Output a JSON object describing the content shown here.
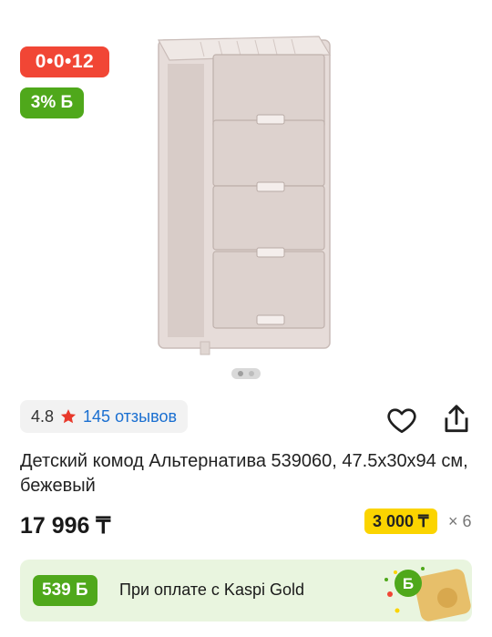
{
  "badges": {
    "installment": "0•0•12",
    "bonus": "3% Б"
  },
  "gallery": {
    "image_name": "product-image",
    "pages": 2,
    "active_page": 1
  },
  "rating": {
    "value": "4.8",
    "reviews": "145 отзывов"
  },
  "product": {
    "title": "Детский комод Альтернатива 539060, 47.5x30x94 см, бежевый",
    "price": "17 996 ₸"
  },
  "installment": {
    "monthly": "3 000 ₸",
    "months": "× 6"
  },
  "gold_banner": {
    "bonus": "539 Б",
    "text": "При оплате с Kaspi Gold"
  },
  "colors": {
    "installment_red": "#f14635",
    "bonus_green": "#4fa81b",
    "monthly_yellow": "#fbd400",
    "link_blue": "#1a6fd1",
    "banner_bg": "#e9f5df"
  }
}
